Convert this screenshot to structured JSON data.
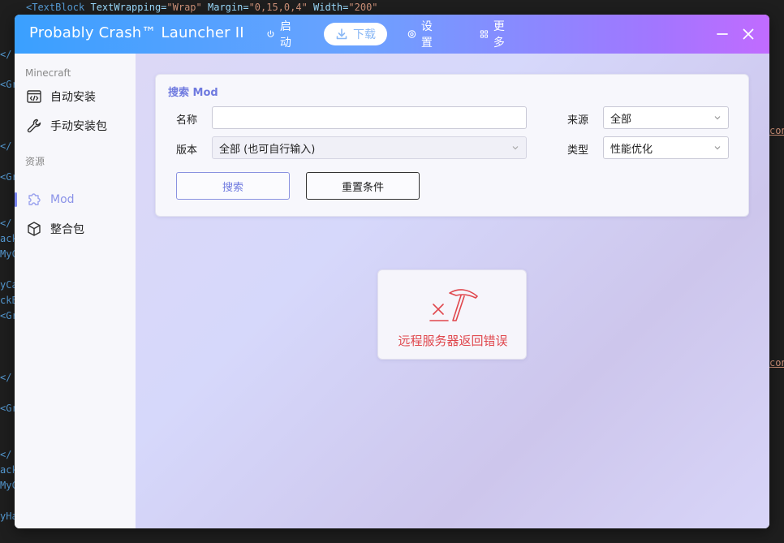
{
  "background_code": {
    "top_line": {
      "tag": "<TextBlock",
      "attr1": " TextWrapping=",
      "val1": "\"Wrap\"",
      "attr2": " Margin=",
      "val2": "\"0,15,0,4\"",
      "attr3": " Width=",
      "val3": "\"200\""
    },
    "left_fragments": [
      "</",
      "<Gr",
      "</",
      "<Gr",
      "</",
      "ack",
      "MyC",
      "yCa",
      "ckB",
      "<Gr",
      "</",
      "<Gr",
      "</",
      "ack",
      "MyC",
      "yHa"
    ],
    "right_fragments": [
      "con",
      "con"
    ]
  },
  "window": {
    "title": "Probably Crash™ Launcher II",
    "nav": [
      {
        "label": "启动",
        "icon": "power-icon"
      },
      {
        "label": "下载",
        "icon": "download-icon",
        "active": true
      },
      {
        "label": "设置",
        "icon": "settings-icon"
      },
      {
        "label": "更多",
        "icon": "grid-icon"
      }
    ]
  },
  "sidebar": {
    "section_minecraft": "Minecraft",
    "auto_install": "自动安装",
    "manual_install": "手动安装包",
    "section_resources": "资源",
    "mod": "Mod",
    "modpack": "整合包"
  },
  "search": {
    "title": "搜索 Mod",
    "name_label": "名称",
    "name_value": "",
    "name_placeholder": "",
    "version_label": "版本",
    "version_value": "全部 (也可自行输入)",
    "source_label": "来源",
    "source_value": "全部",
    "type_label": "类型",
    "type_value": "性能优化",
    "search_button": "搜索",
    "reset_button": "重置条件"
  },
  "error": {
    "message": "远程服务器返回错误"
  },
  "colors": {
    "accent": "#6f7adf",
    "error": "#e0474d",
    "title_gradient_start": "#3aa0ff",
    "title_gradient_end": "#c16bff"
  }
}
